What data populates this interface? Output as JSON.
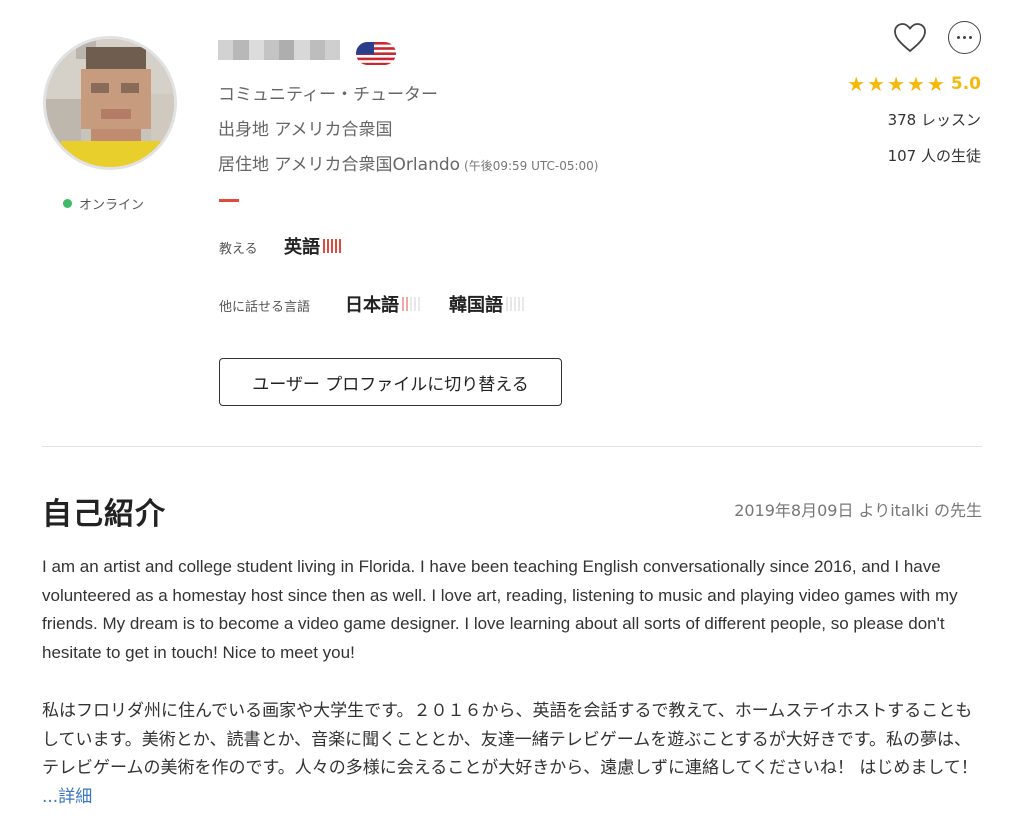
{
  "profile": {
    "status": "オンライン",
    "role": "コミュニティー・チューター",
    "origin": "出身地 アメリカ合衆国",
    "residence": "居住地 アメリカ合衆国Orlando",
    "local_time": "(午後09:59 UTC-05:00)",
    "flag_icon": "us-flag-icon",
    "status_color": "#3dba6a"
  },
  "teaches": {
    "label": "教える",
    "language": "英語",
    "level": 5
  },
  "speaks": {
    "label": "他に話せる言語",
    "languages": [
      {
        "name": "日本語",
        "level": 2
      },
      {
        "name": "韓国語",
        "level": 0
      }
    ]
  },
  "switch_button": "ユーザー プロファイルに切り替える",
  "actions": {
    "favorite_icon": "heart-icon",
    "more_icon": "more-options-icon"
  },
  "rating": {
    "stars": 5,
    "value": "5.0",
    "lessons": "378 レッスン",
    "students": "107 人の生徒",
    "star_color": "#f5b90c"
  },
  "about": {
    "title": "自己紹介",
    "since": "2019年8月09日 よりitalki の先生",
    "paragraph_en": "I am an artist and college student living in Florida. I have been teaching English conversationally since 2016, and I have volunteered as a homestay host since then as well. I love art, reading, listening to music and playing video games with my friends. My dream is to become a video game designer. I love learning about all sorts of different people, so please don't hesitate to get in touch! Nice to meet you!",
    "paragraph_ja": "私はフロリダ州に住んでいる画家や大学生です。２０１６から、英語を会話するで教えて、ホームステイホストすることもしています。美術とか、読書とか、音楽に聞くこととか、友達一緒テレビゲームを遊ぶことするが大好きです。私の夢は、テレビゲームの美術を作のです。人々の多様に会えることが大好きから、遠慮しずに連絡してくださいね！ はじめまして！",
    "more_link": "...詳細"
  },
  "colors": {
    "accent_red": "#e4493d",
    "link_blue": "#3a76c2"
  }
}
